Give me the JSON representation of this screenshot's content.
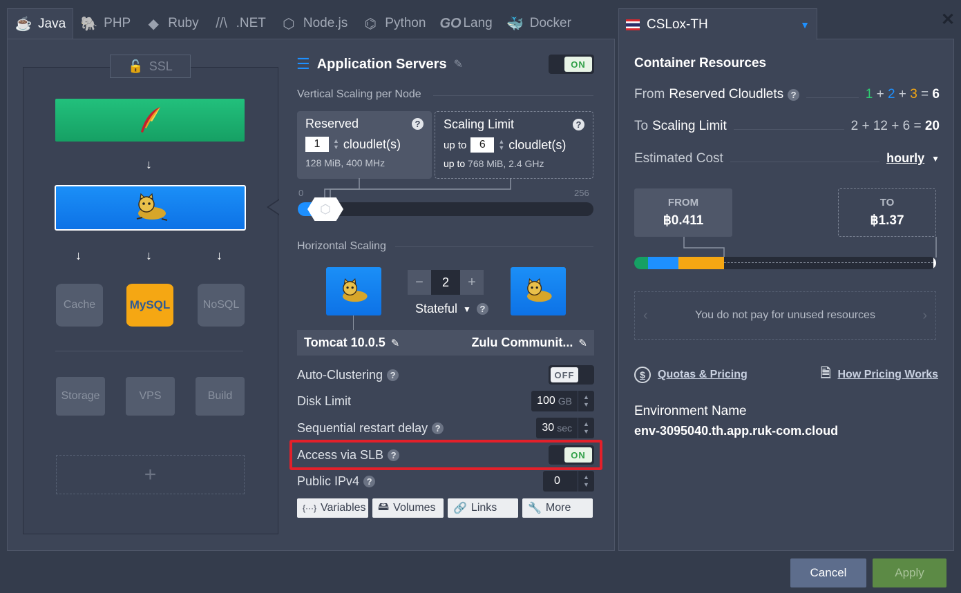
{
  "tabs": [
    {
      "label": "Java",
      "icon": "java-icon",
      "glyph": "☕"
    },
    {
      "label": "PHP",
      "icon": "php-elephant-icon",
      "glyph": "🐘"
    },
    {
      "label": "Ruby",
      "icon": "ruby-gem-icon",
      "glyph": "◆"
    },
    {
      "label": ".NET",
      "icon": "dotnet-icon",
      "glyph": "//\\"
    },
    {
      "label": "Node.js",
      "icon": "nodejs-icon",
      "glyph": "⬡"
    },
    {
      "label": "Python",
      "icon": "python-icon",
      "glyph": "⌬"
    },
    {
      "label": "Lang",
      "icon": "go-icon",
      "glyph": "GO"
    },
    {
      "label": "Docker",
      "icon": "docker-whale-icon",
      "glyph": "🐳"
    }
  ],
  "topology": {
    "ssl_label": "SSL",
    "dbs": [
      "Cache",
      "MySQL",
      "NoSQL"
    ],
    "extras": [
      "Storage",
      "VPS",
      "Build"
    ],
    "add_glyph": "+"
  },
  "app_servers": {
    "title": "Application Servers",
    "toggle": "ON",
    "vertical_label": "Vertical Scaling per Node",
    "reserved": {
      "title": "Reserved",
      "value": "1",
      "unit": "cloudlet(s)",
      "sub": "128 MiB, 400 MHz"
    },
    "limit": {
      "title": "Scaling Limit",
      "prefix": "up to",
      "value": "6",
      "unit": "cloudlet(s)",
      "sub_prefix": "up to",
      "sub": "768 MiB, 2.4 GHz"
    },
    "slider_min": "0",
    "slider_max": "256",
    "horizontal_label": "Horizontal Scaling",
    "count": "2",
    "mode": "Stateful",
    "version_left": "Tomcat 10.0.5",
    "version_right": "Zulu Communit...",
    "auto_clustering": {
      "label": "Auto-Clustering",
      "toggle": "OFF"
    },
    "disk_limit": {
      "label": "Disk Limit",
      "value": "100",
      "unit": "GB"
    },
    "restart_delay": {
      "label": "Sequential restart delay",
      "value": "30",
      "unit": "sec"
    },
    "slb": {
      "label": "Access via SLB",
      "toggle": "ON"
    },
    "ipv4": {
      "label": "Public IPv4",
      "value": "0"
    },
    "buttons": [
      {
        "label": "Variables",
        "glyph": "{···}"
      },
      {
        "label": "Volumes",
        "glyph": "🖴"
      },
      {
        "label": "Links",
        "glyph": "🔗"
      },
      {
        "label": "More",
        "glyph": "🔧"
      }
    ]
  },
  "env": {
    "name": "CSLox-TH",
    "flag_colors": [
      "#d8282e",
      "#ffffff",
      "#2b2d68"
    ],
    "resources_title": "Container Resources",
    "from_reserved": {
      "prefix": "From",
      "label": "Reserved Cloudlets",
      "a": "1",
      "b": "2",
      "c": "3",
      "total": "6"
    },
    "to_limit": {
      "prefix": "To",
      "label": "Scaling Limit",
      "expr": "2 + 12 + 6 =",
      "total": "20"
    },
    "estimated": {
      "label": "Estimated Cost",
      "period": "hourly"
    },
    "from_cost": {
      "label": "FROM",
      "value": "฿0.411"
    },
    "to_cost": {
      "label": "TO",
      "value": "฿1.37"
    },
    "unused_note": "You do not pay for unused resources",
    "quotas_link": "Quotas & Pricing",
    "how_link": "How Pricing Works",
    "env_name_label": "Environment Name",
    "env_name_value": "env-3095040.th.app.ruk-com.cloud"
  },
  "footer": {
    "cancel": "Cancel",
    "apply": "Apply"
  },
  "colors": {
    "accent": "#1e90ff",
    "green": "#16a064",
    "mysql": "#f5a713",
    "cloudlet1": "#2ecc71",
    "cloudlet2": "#1e90ff",
    "cloudlet3": "#f5a713",
    "highlight": "#e3202a"
  }
}
